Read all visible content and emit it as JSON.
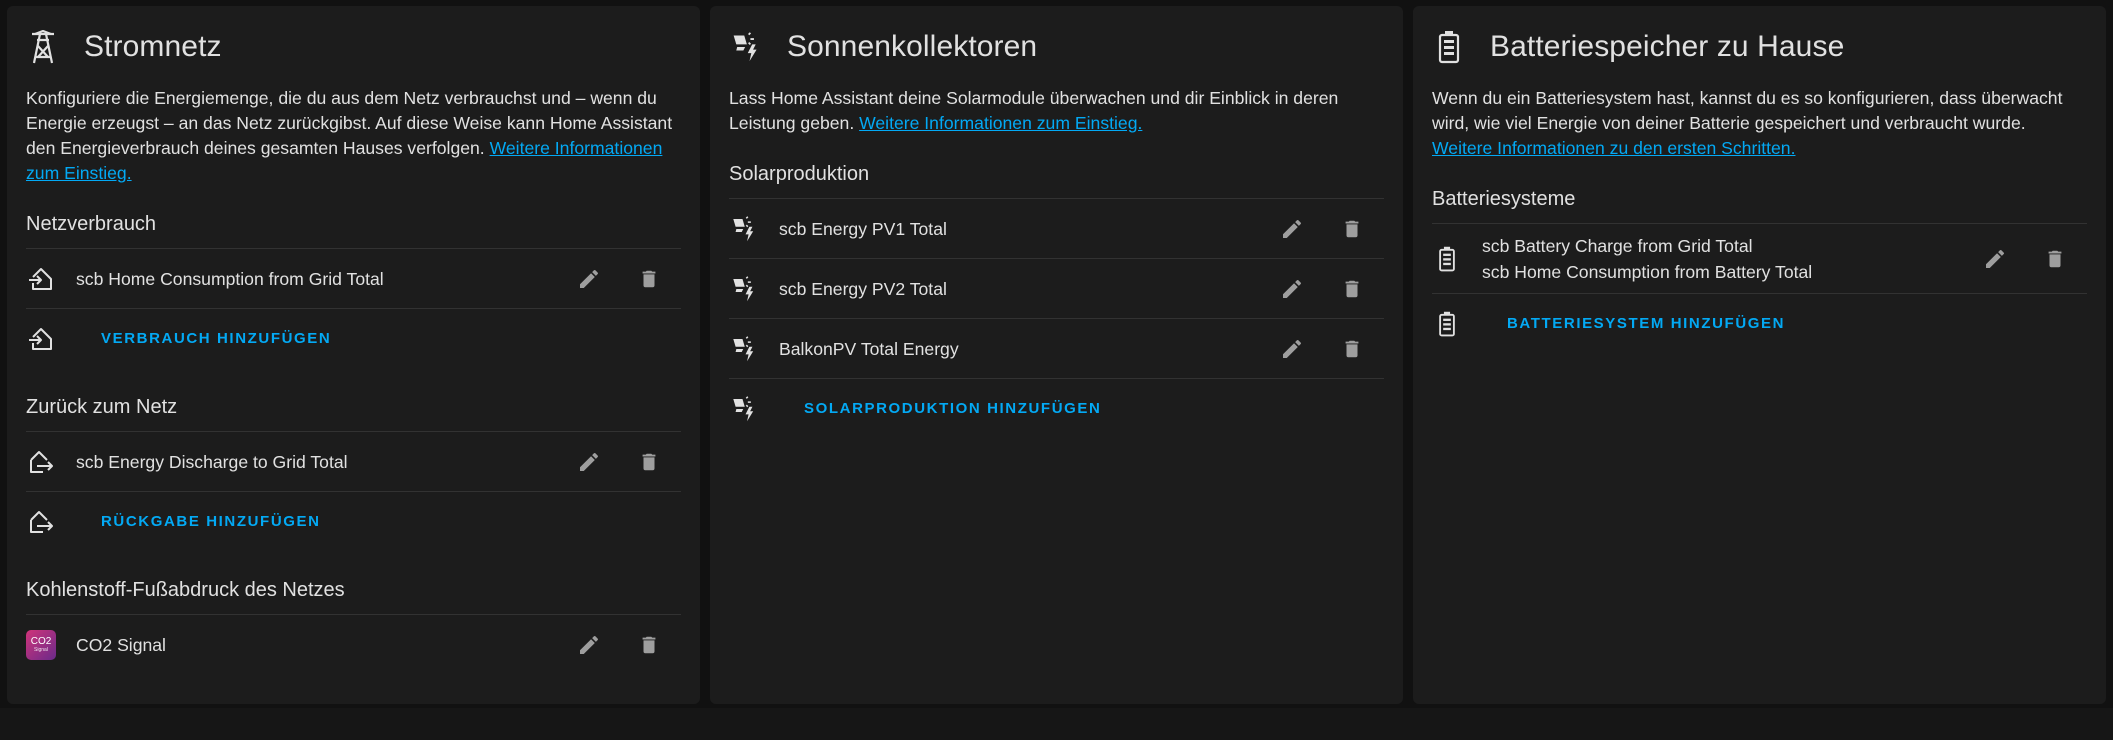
{
  "grid": {
    "title": "Stromnetz",
    "description": "Konfiguriere die Energiemenge, die du aus dem Netz verbrauchst und – wenn du Energie erzeugst – an das Netz zurückgibst. Auf diese Weise kann Home Assistant den Energieverbrauch deines gesamten Hauses verfolgen.",
    "link": "Weitere Informationen zum Einstieg.",
    "consumption": {
      "title": "Netzverbrauch",
      "items": [
        "scb Home Consumption from Grid Total"
      ],
      "add_label": "VERBRAUCH HINZUFÜGEN"
    },
    "return": {
      "title": "Zurück zum Netz",
      "items": [
        "scb Energy Discharge to Grid Total"
      ],
      "add_label": "RÜCKGABE HINZUFÜGEN"
    },
    "carbon": {
      "title": "Kohlenstoff-Fußabdruck des Netzes",
      "items": [
        "CO2 Signal"
      ],
      "badge_text": "CO2",
      "badge_sub": "Signal"
    }
  },
  "solar": {
    "title": "Sonnenkollektoren",
    "description": "Lass Home Assistant deine Solarmodule überwachen und dir Einblick in deren Leistung geben.",
    "link": "Weitere Informationen zum Einstieg.",
    "production": {
      "title": "Solarproduktion",
      "items": [
        "scb Energy PV1 Total",
        "scb Energy PV2 Total",
        "BalkonPV Total Energy"
      ],
      "add_label": "SOLARPRODUKTION HINZUFÜGEN"
    }
  },
  "battery": {
    "title": "Batteriespeicher zu Hause",
    "description": "Wenn du ein Batteriesystem hast, kannst du es so konfigurieren, dass überwacht wird, wie viel Energie von deiner Batterie gespeichert und verbraucht wurde.",
    "link": "Weitere Informationen zu den ersten Schritten.",
    "systems": {
      "title": "Batteriesysteme",
      "items": [
        {
          "line1": "scb Battery Charge from Grid Total",
          "line2": "scb Home Consumption from Battery Total"
        }
      ],
      "add_label": "BATTERIESYSTEM HINZUFÜGEN"
    }
  },
  "icons": {
    "grid": "transmission-tower-icon",
    "solar": "solar-power-icon",
    "battery": "battery-icon",
    "import": "home-import-icon",
    "export": "home-export-icon",
    "edit": "pencil-icon",
    "delete": "trash-icon"
  },
  "colors": {
    "accent": "#03a9f4",
    "card_bg": "#1c1c1c",
    "page_bg": "#111111",
    "text": "#e1e1e1",
    "icon_action": "#9e9e9e"
  }
}
